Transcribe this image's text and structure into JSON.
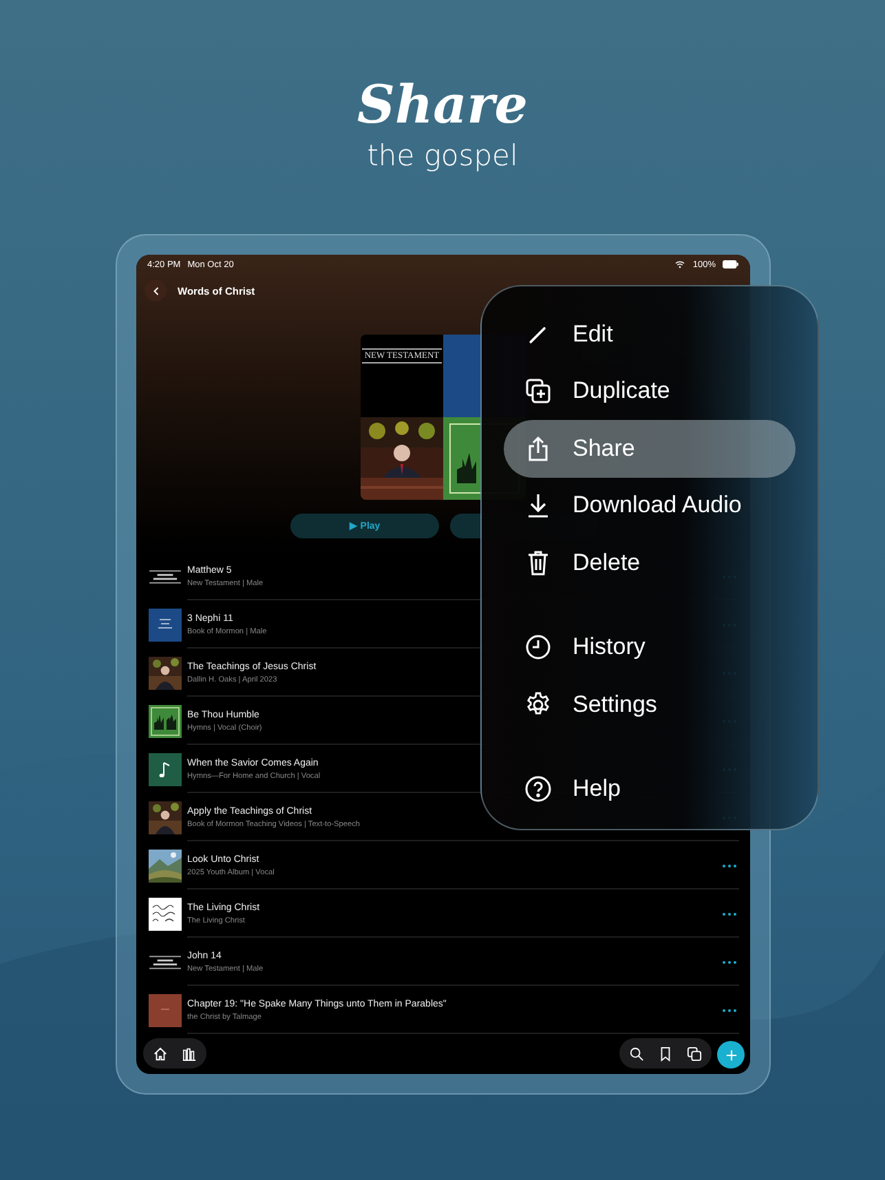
{
  "headline": {
    "title": "Share",
    "subtitle": "the gospel"
  },
  "status_bar": {
    "time": "4:20 PM",
    "date": "Mon Oct 20",
    "battery": "100%"
  },
  "header": {
    "title": "Words of Christ"
  },
  "cover": {
    "text": "NEW TESTAMENT"
  },
  "play_button": {
    "icon": "▶",
    "label": "Play"
  },
  "items": [
    {
      "title": "Matthew 5",
      "subtitle": "New Testament | Male"
    },
    {
      "title": "3 Nephi 11",
      "subtitle": "Book of Mormon | Male"
    },
    {
      "title": "The Teachings of Jesus Christ",
      "subtitle": "Dallin H. Oaks | April 2023"
    },
    {
      "title": "Be Thou Humble",
      "subtitle": "Hymns | Vocal (Choir)"
    },
    {
      "title": "When the Savior Comes Again",
      "subtitle": "Hymns—For Home and Church | Vocal"
    },
    {
      "title": "Apply the Teachings of Christ",
      "subtitle": "Book of Mormon Teaching Videos | Text-to-Speech"
    },
    {
      "title": "Look Unto Christ",
      "subtitle": "2025 Youth Album | Vocal"
    },
    {
      "title": "The Living Christ",
      "subtitle": "The Living Christ"
    },
    {
      "title": "John 14",
      "subtitle": "New Testament | Male"
    },
    {
      "title": "Chapter 19: \"He Spake Many Things unto Them in Parables\"",
      "subtitle": "the Christ by Talmage"
    }
  ],
  "menu": {
    "sections": [
      [
        {
          "label": "Edit",
          "selected": false
        },
        {
          "label": "Duplicate",
          "selected": false
        },
        {
          "label": "Share",
          "selected": true
        },
        {
          "label": "Download Audio",
          "selected": false
        },
        {
          "label": "Delete",
          "selected": false
        }
      ],
      [
        {
          "label": "History",
          "selected": false
        },
        {
          "label": "Settings",
          "selected": false
        }
      ],
      [
        {
          "label": "Help",
          "selected": false
        }
      ]
    ]
  }
}
